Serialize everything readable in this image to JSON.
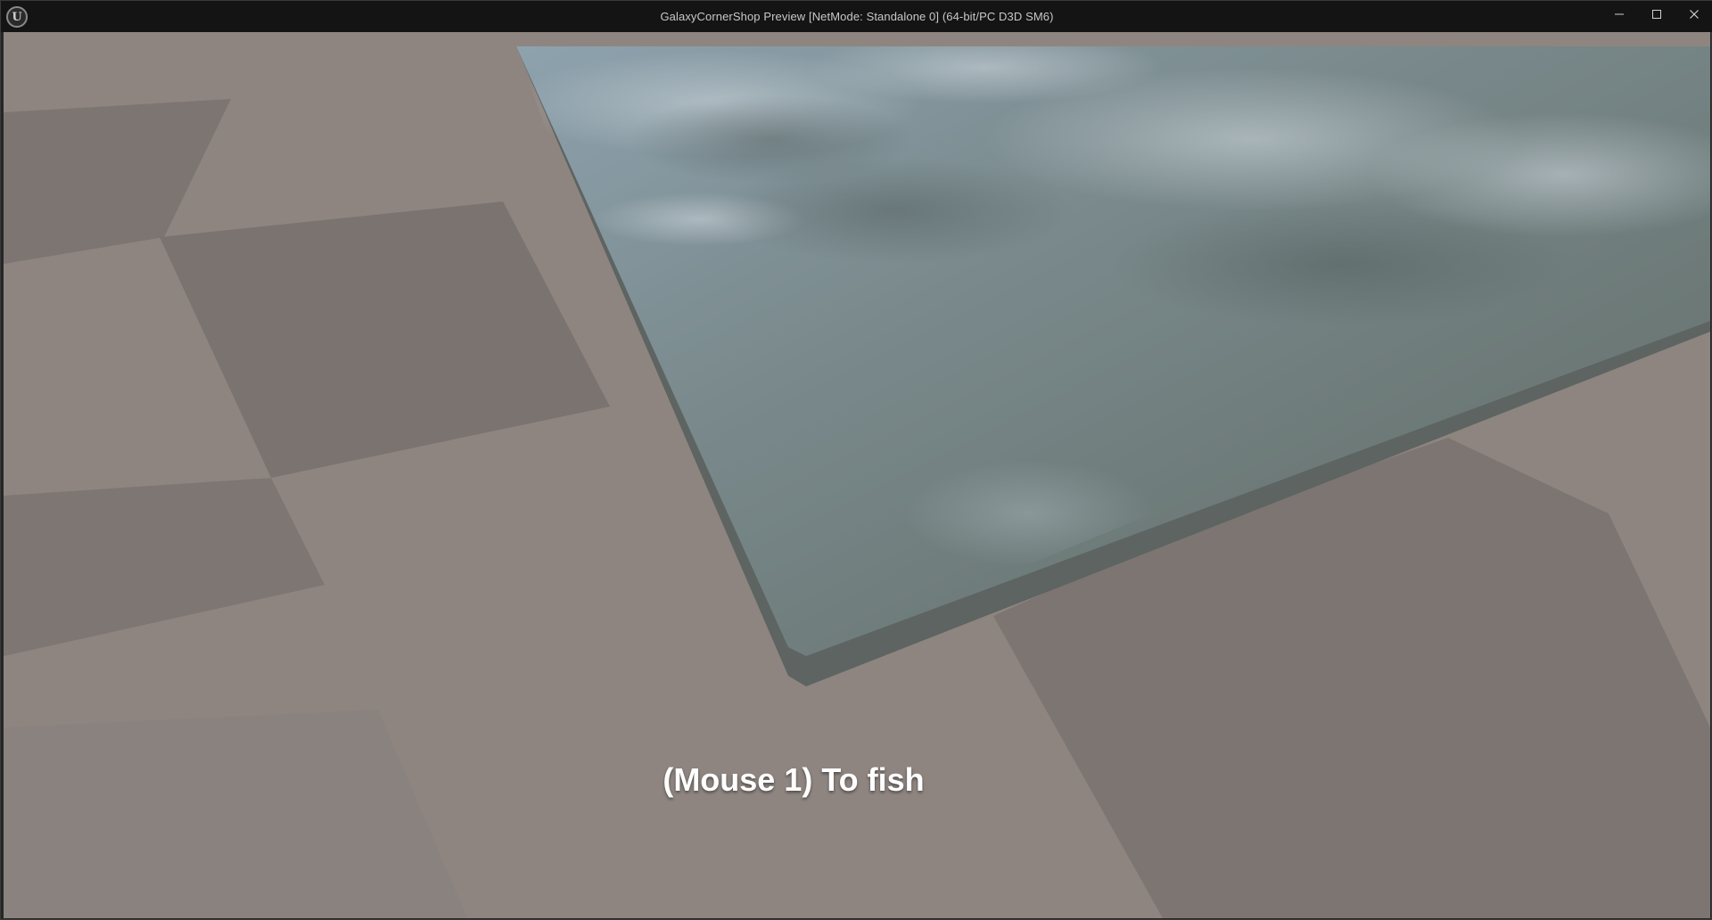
{
  "window": {
    "title": "GalaxyCornerShop Preview [NetMode: Standalone 0]  (64-bit/PC D3D SM6)",
    "logo": "U",
    "controls": [
      "minimize-icon",
      "maximize-icon",
      "close-icon"
    ]
  },
  "viewport": {
    "scene": {
      "floor_color": "#8e8580",
      "floor_dark_tile_color": "#7d7672",
      "water_color": "#6f7d7c",
      "water_edge_color": "#5d6461"
    },
    "prompt_text": "(Mouse 1) To fish"
  }
}
